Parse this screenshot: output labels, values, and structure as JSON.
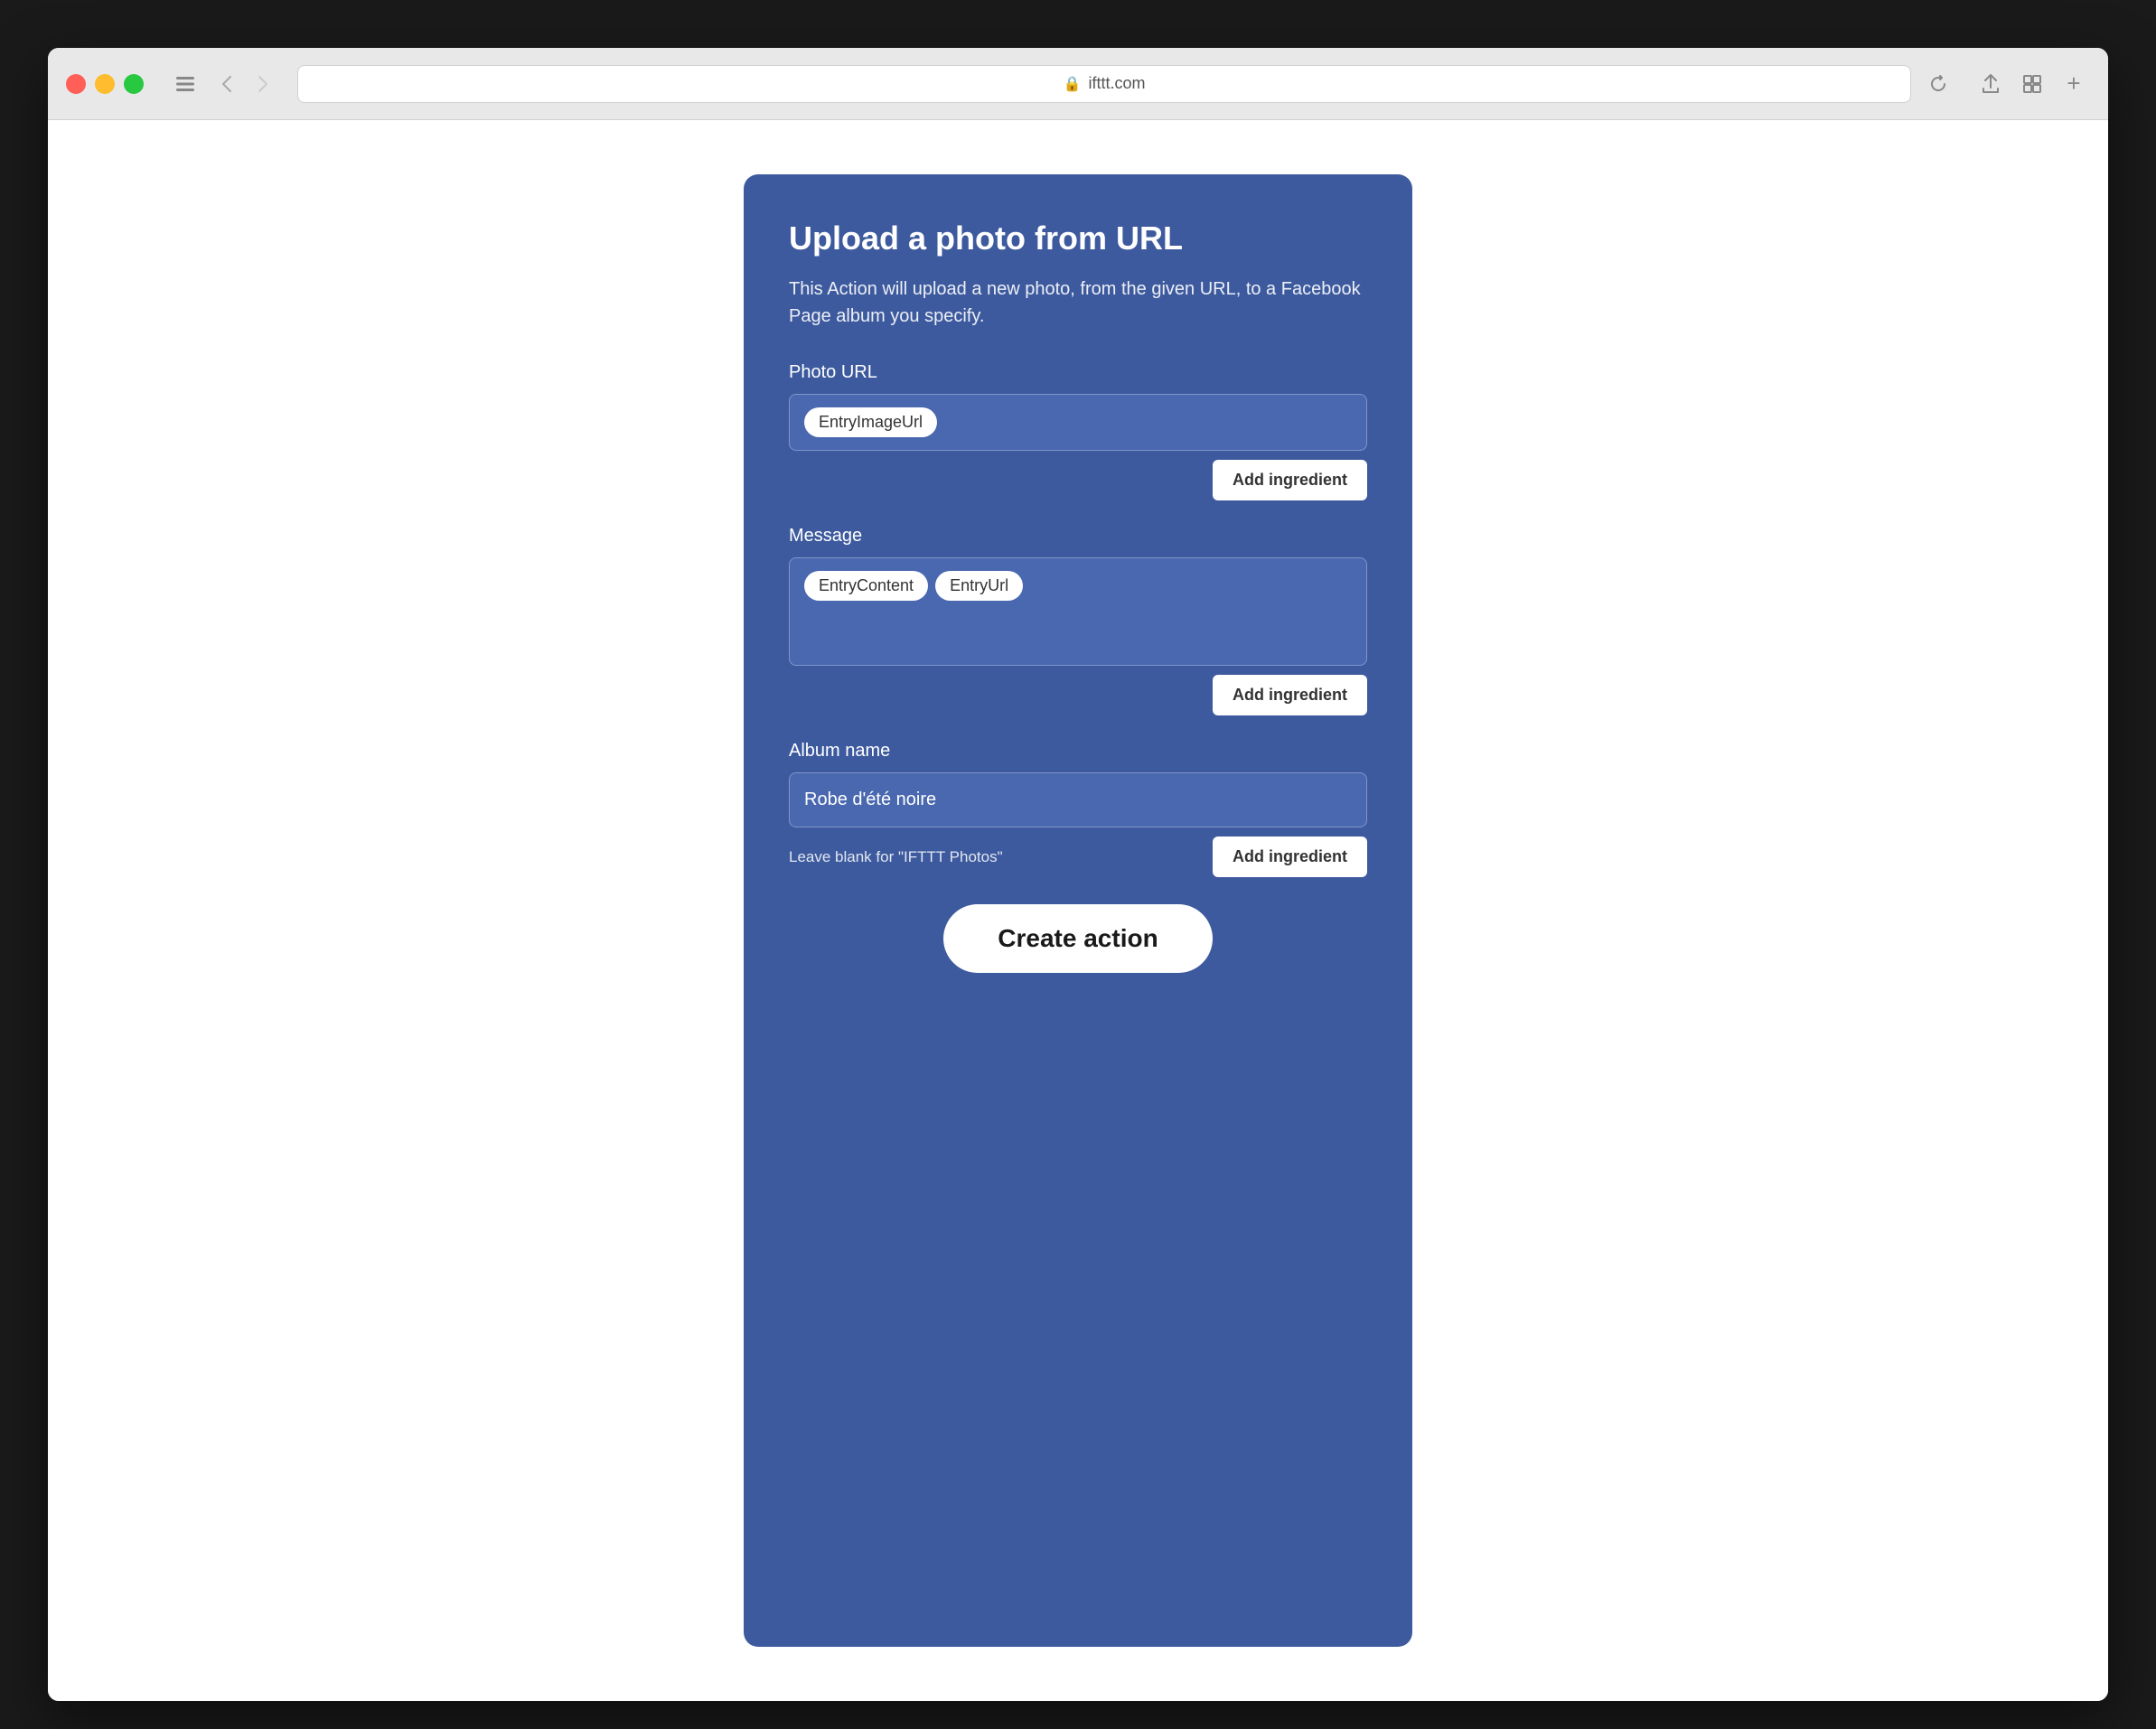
{
  "browser": {
    "url": "ifttt.com",
    "back_label": "‹",
    "forward_label": "›",
    "reload_label": "↺",
    "share_label": "⎙",
    "tabs_label": "⧉",
    "new_tab_label": "+"
  },
  "card": {
    "title": "Upload a photo from URL",
    "description": "This Action will upload a new photo, from the given URL, to a Facebook Page album you specify.",
    "photo_url_label": "Photo URL",
    "photo_url_tags": [
      "EntryImageUrl"
    ],
    "add_ingredient_1": "Add ingredient",
    "message_label": "Message",
    "message_tags": [
      "EntryContent",
      "EntryUrl"
    ],
    "add_ingredient_2": "Add ingredient",
    "album_name_label": "Album name",
    "album_name_value": "Robe d'été noire",
    "album_name_helper": "Leave blank for \"IFTTT Photos\"",
    "add_ingredient_3": "Add ingredient",
    "create_action_label": "Create action"
  }
}
